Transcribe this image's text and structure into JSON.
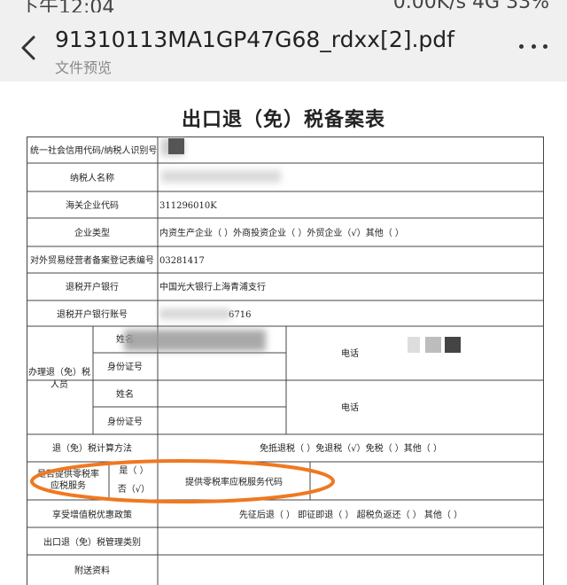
{
  "status_bar": {
    "time": "下午12:04",
    "network_speed": "0.00K/s",
    "signal": "4G",
    "battery": "33%"
  },
  "header": {
    "title": "91310113MA1GP47G68_rdxx[2].pdf",
    "subtitle": "文件预览"
  },
  "document": {
    "title": "出口退（免）税备案表",
    "rows": {
      "credit_code_label": "统一社会信用代码/纳税人识别号",
      "taxpayer_name_label": "纳税人名称",
      "customs_code_label": "海关企业代码",
      "customs_code_value": "311296010K",
      "enterprise_type_label": "企业类型",
      "enterprise_type_value": "内资生产企业（ ）外商投资企业（ ）外贸企业（√）其他（ ）",
      "foreign_trade_label": "对外贸易经营者备案登记表编号",
      "foreign_trade_value": "03281417",
      "bank_label": "退税开户银行",
      "bank_value": "中国光大银行上海青浦支行",
      "account_label": "退税开户银行账号",
      "account_value": "6716",
      "handler_label_1": "办理退（免）税",
      "handler_label_2": "人员",
      "name_label": "姓名",
      "id_label": "身份证号",
      "phone_label": "电话",
      "calc_method_label": "退（免）税计算方法",
      "calc_method_value": "免抵退税（ ）免退税（√）免税（ ）其他（ ）",
      "zero_rate_label_1": "是否提供零税率",
      "zero_rate_label_2": "应税服务",
      "yes_option": "是（ ）",
      "no_option": "否（√）",
      "zero_rate_code_label": "提供零税率应税服务代码",
      "vat_label": "享受增值税优惠政策",
      "vat_value": "先征后退（ ）  即征即退（ ）  超税负返还（ ）  其他（ ）",
      "mgmt_label": "出口退（免）税管理类别",
      "attachments_label": "附送资料"
    }
  },
  "colors": {
    "annotation": "#f07820",
    "redaction": "#555555"
  }
}
